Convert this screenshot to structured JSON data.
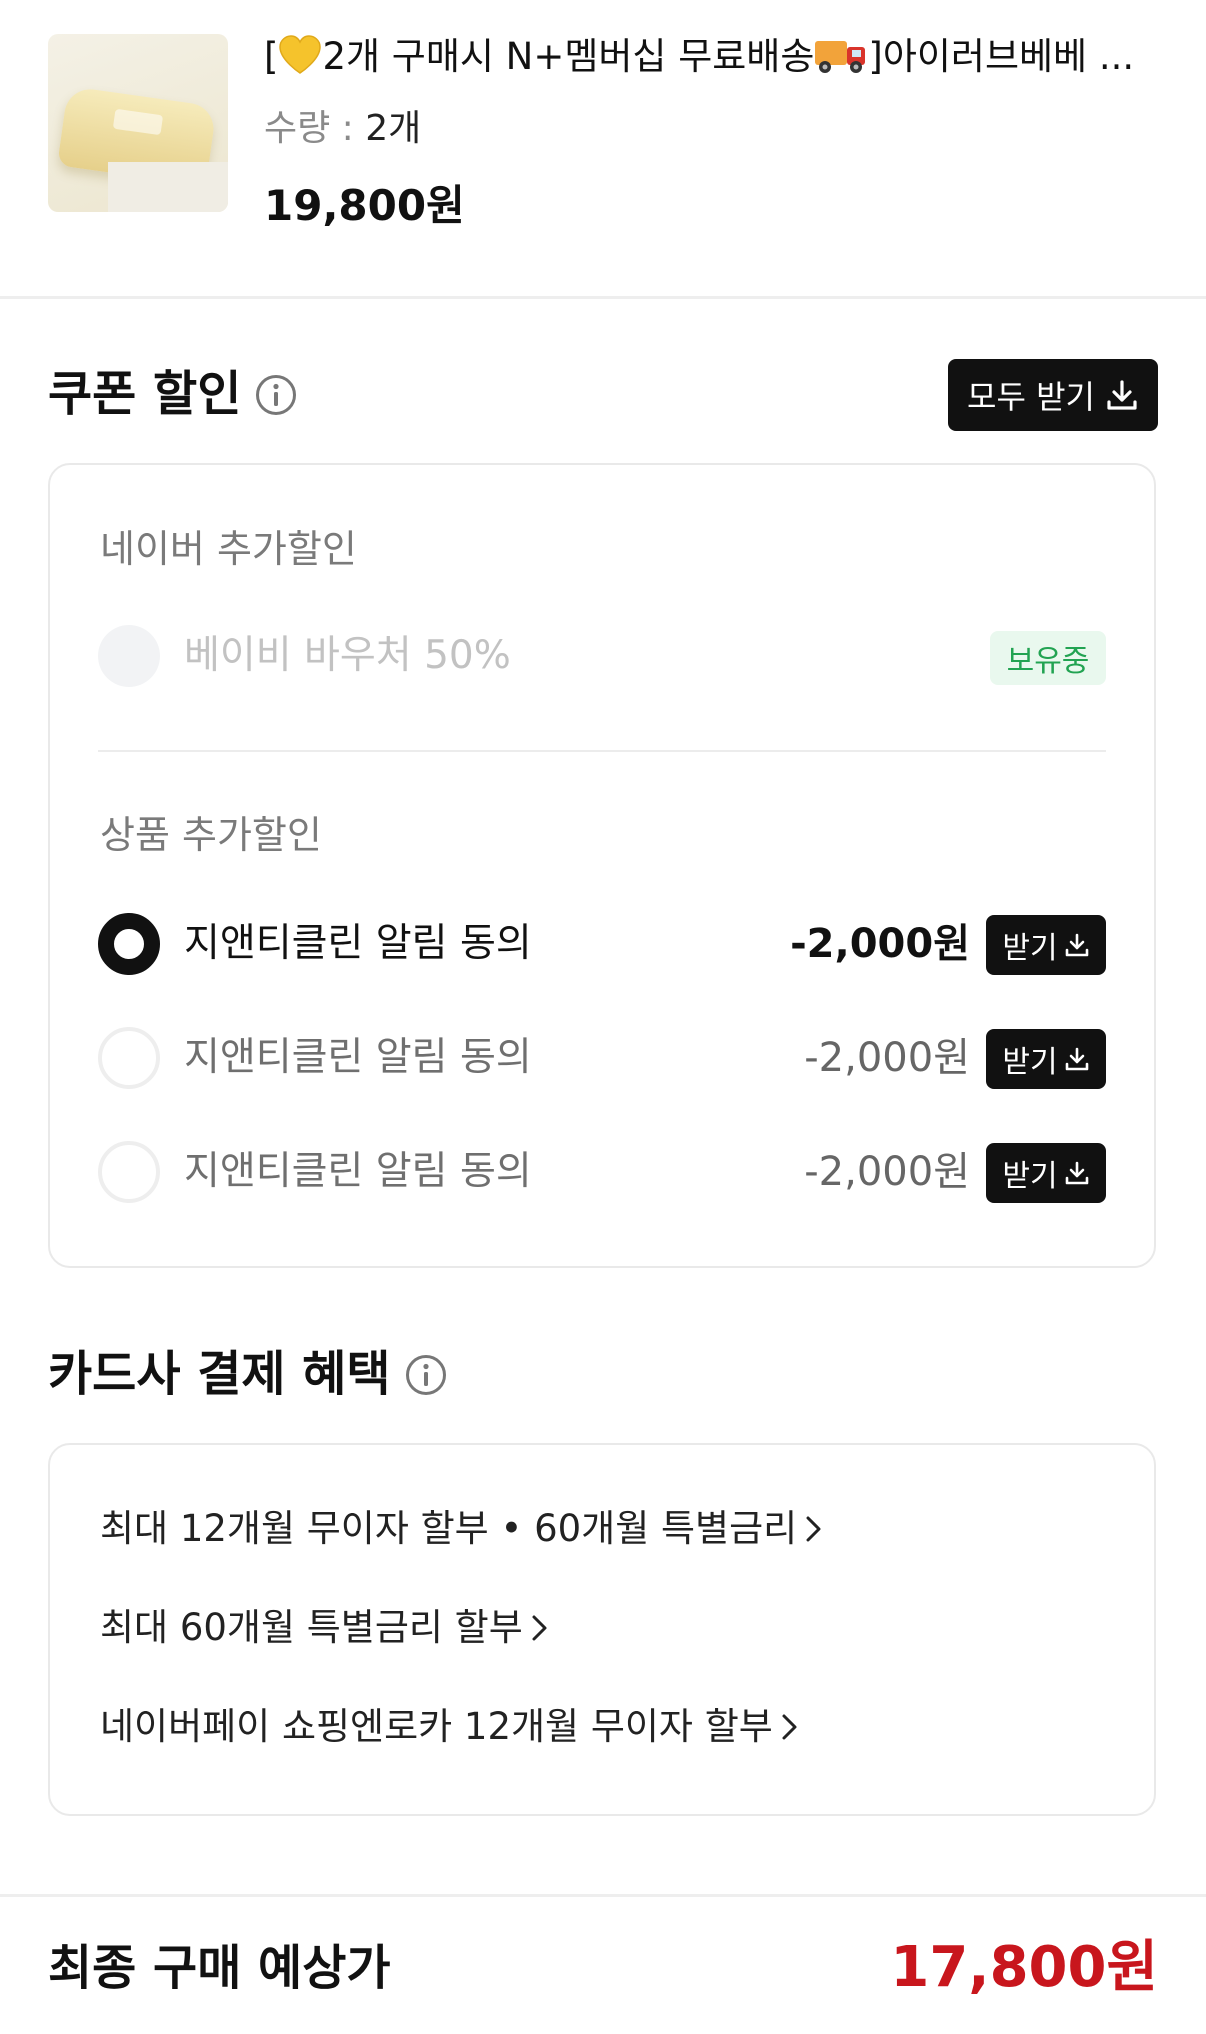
{
  "product": {
    "title": "[💛2개 구매시 N+멤버십 무료배송🚚]아이러브베베 ...",
    "title_parts": [
      "[",
      "2개 구매시 N+멤버십 무료배송",
      "]아이러브베베 ..."
    ],
    "qty_label": "수량 : ",
    "qty_value": "2개",
    "price": "19,800원"
  },
  "coupon": {
    "title": "쿠폰 할인",
    "get_all_label": "모두 받기",
    "naver_section": "네이버 추가할인",
    "naver_item": {
      "label": "베이비 바우처 50%",
      "badge": "보유중"
    },
    "product_section": "상품 추가할인",
    "items": [
      {
        "label": "지앤티클린 알림 동의",
        "amount": "-2,000원",
        "button": "받기",
        "selected": true
      },
      {
        "label": "지앤티클린 알림 동의",
        "amount": "-2,000원",
        "button": "받기",
        "selected": false
      },
      {
        "label": "지앤티클린 알림 동의",
        "amount": "-2,000원",
        "button": "받기",
        "selected": false
      }
    ]
  },
  "card_benefit": {
    "title": "카드사 결제 혜택",
    "lines": [
      "최대 12개월 무이자 할부 • 60개월 특별금리",
      "최대 60개월 특별금리 할부",
      "네이버페이 쇼핑엔로카 12개월 무이자 할부"
    ]
  },
  "final": {
    "label": "최종 구매 예상가",
    "price": "17,800원"
  },
  "colors": {
    "accent_red": "#c8161d",
    "badge_green": "#22a352",
    "badge_bg": "#e9f8ee",
    "button_black": "#111111"
  },
  "icons": [
    "info-icon",
    "download-icon",
    "chevron-right-icon",
    "heart-emoji-icon",
    "truck-emoji-icon"
  ]
}
